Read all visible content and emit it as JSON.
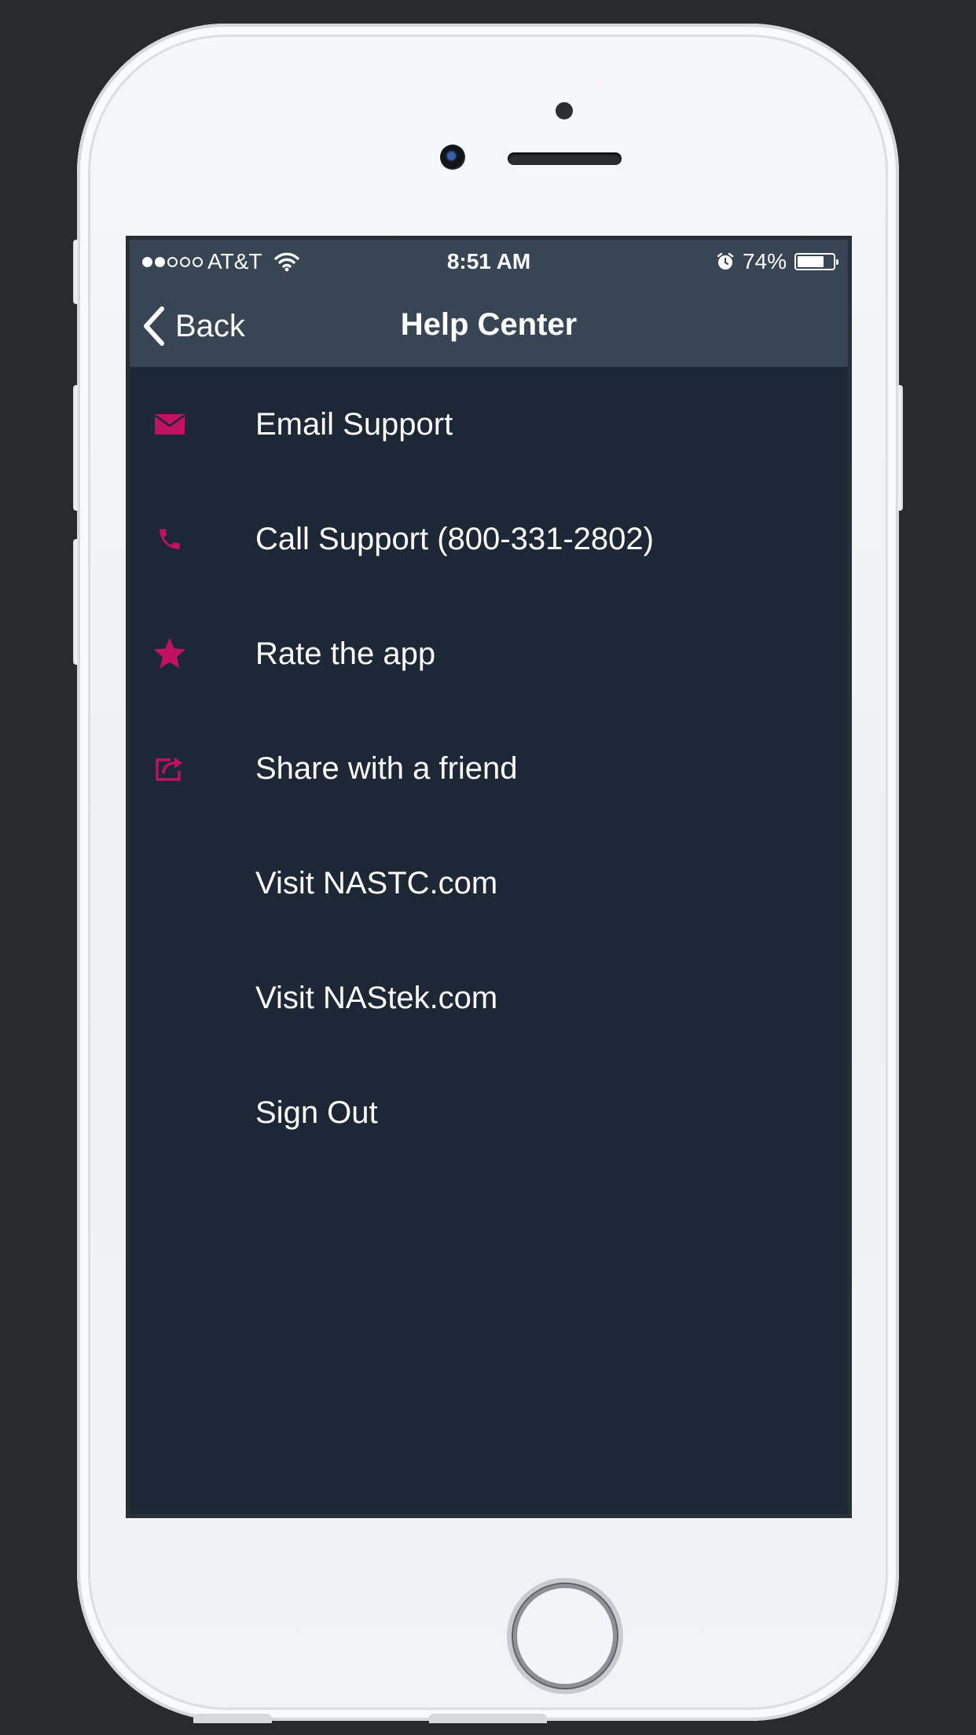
{
  "status_bar": {
    "carrier": "AT&T",
    "time": "8:51 AM",
    "battery_percent": "74%",
    "battery_level": 0.74,
    "signal_bars_filled": 2,
    "signal_bars_total": 5,
    "wifi_icon": "wifi-icon",
    "alarm_icon": "alarm-icon"
  },
  "nav": {
    "back_label": "Back",
    "title": "Help Center",
    "back_icon": "chevron-left-icon"
  },
  "menu": {
    "accent_color": "#c2125f",
    "items": [
      {
        "label": "Email Support",
        "icon": "envelope-icon"
      },
      {
        "label": "Call Support (800-331-2802)",
        "icon": "phone-icon"
      },
      {
        "label": "Rate the app",
        "icon": "star-icon"
      },
      {
        "label": "Share with a friend",
        "icon": "share-icon"
      },
      {
        "label": "Visit NASTC.com",
        "icon": ""
      },
      {
        "label": "Visit NAStek.com",
        "icon": ""
      },
      {
        "label": "Sign Out",
        "icon": ""
      }
    ]
  },
  "colors": {
    "background": "#1c2835",
    "header": "#374555",
    "text": "#ffffff"
  }
}
